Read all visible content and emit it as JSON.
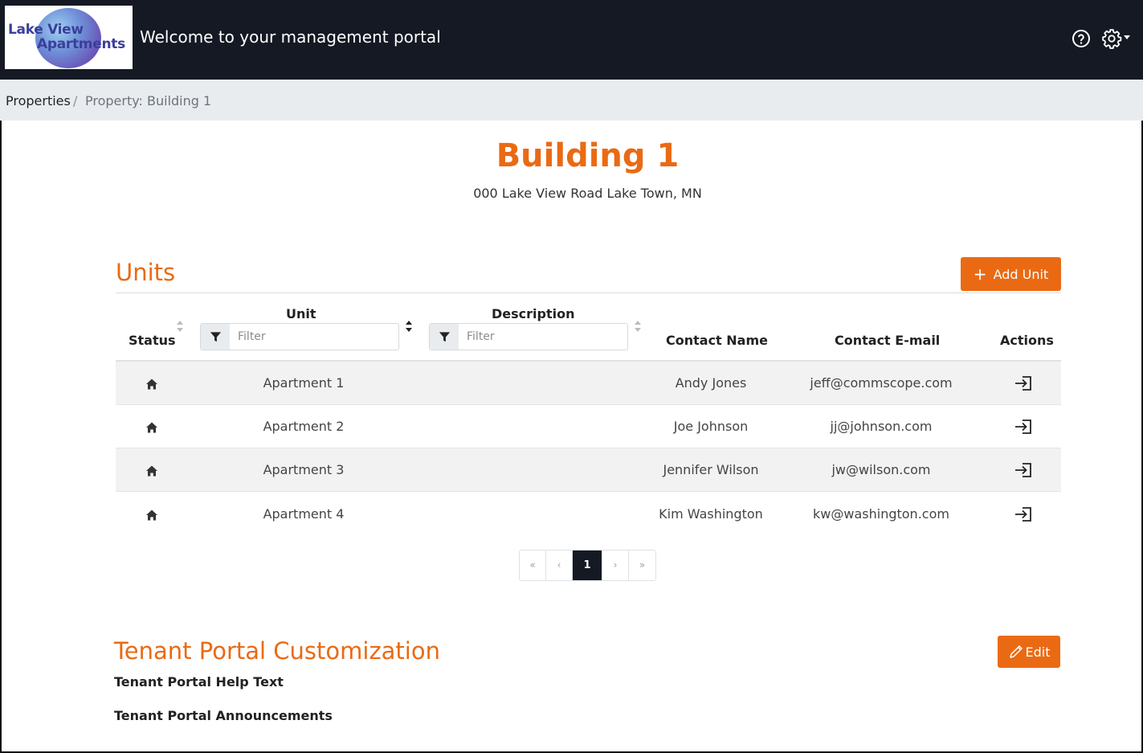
{
  "header": {
    "logo_line1": "Lake View",
    "logo_line2": "Apartments",
    "welcome": "Welcome to your management portal",
    "help_icon": "help-circle-icon",
    "settings_icon": "gear-icon"
  },
  "breadcrumb": {
    "root": "Properties",
    "separator": "/",
    "current": "Property: Building 1"
  },
  "property": {
    "title": "Building 1",
    "address": "000 Lake View Road Lake Town, MN"
  },
  "units": {
    "title": "Units",
    "add_button_label": "Add Unit",
    "columns": {
      "status": "Status",
      "unit": "Unit",
      "description": "Description",
      "contact_name": "Contact Name",
      "contact_email": "Contact E-mail",
      "actions": "Actions"
    },
    "filter_placeholder": "Filter",
    "rows": [
      {
        "status_icon": "home-icon",
        "unit": "Apartment 1",
        "description": "",
        "contact_name": "Andy Jones",
        "contact_email": "jeff@commscope.com",
        "action_icon": "sign-in-icon"
      },
      {
        "status_icon": "home-icon",
        "unit": "Apartment 2",
        "description": "",
        "contact_name": "Joe Johnson",
        "contact_email": "jj@johnson.com",
        "action_icon": "sign-in-icon"
      },
      {
        "status_icon": "home-icon",
        "unit": "Apartment 3",
        "description": "",
        "contact_name": "Jennifer Wilson",
        "contact_email": "jw@wilson.com",
        "action_icon": "sign-in-icon"
      },
      {
        "status_icon": "home-icon",
        "unit": "Apartment 4",
        "description": "",
        "contact_name": "Kim Washington",
        "contact_email": "kw@washington.com",
        "action_icon": "sign-in-icon"
      }
    ],
    "pagination": {
      "first": "«",
      "prev": "‹",
      "current_page": "1",
      "next": "›",
      "last": "»"
    }
  },
  "tenant_portal": {
    "title": "Tenant Portal Customization",
    "edit_button_label": "Edit",
    "help_text_label": "Tenant Portal Help Text",
    "announcements_label": "Tenant Portal Announcements"
  },
  "colors": {
    "accent": "#ea6a14",
    "header_bg": "#141923",
    "breadcrumb_bg": "#e9ecef",
    "row_stripe": "#f2f2f2"
  }
}
